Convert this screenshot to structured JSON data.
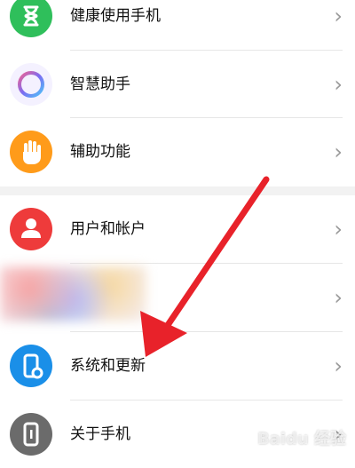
{
  "settings": {
    "items": [
      {
        "label": "健康使用手机",
        "icon": "hourglass-icon",
        "color": "#2fbf5b"
      },
      {
        "label": "智慧助手",
        "icon": "assistant-ring-icon",
        "color": "#8f6cf0"
      },
      {
        "label": "辅助功能",
        "icon": "hand-icon",
        "color": "#ff9b1a"
      },
      {
        "label": "用户和帐户",
        "icon": "user-icon",
        "color": "#ee3b3b"
      },
      {
        "label": "",
        "icon": "blurred-icon",
        "color": "#f1c2d6"
      },
      {
        "label": "系统和更新",
        "icon": "phone-settings-icon",
        "color": "#1a8fe8"
      },
      {
        "label": "关于手机",
        "icon": "phone-info-icon",
        "color": "#6b6b6b"
      }
    ],
    "chevron": "›"
  },
  "watermark": {
    "text": "Baidu 经验"
  },
  "annotation": {
    "arrow_color": "#e8222a"
  }
}
